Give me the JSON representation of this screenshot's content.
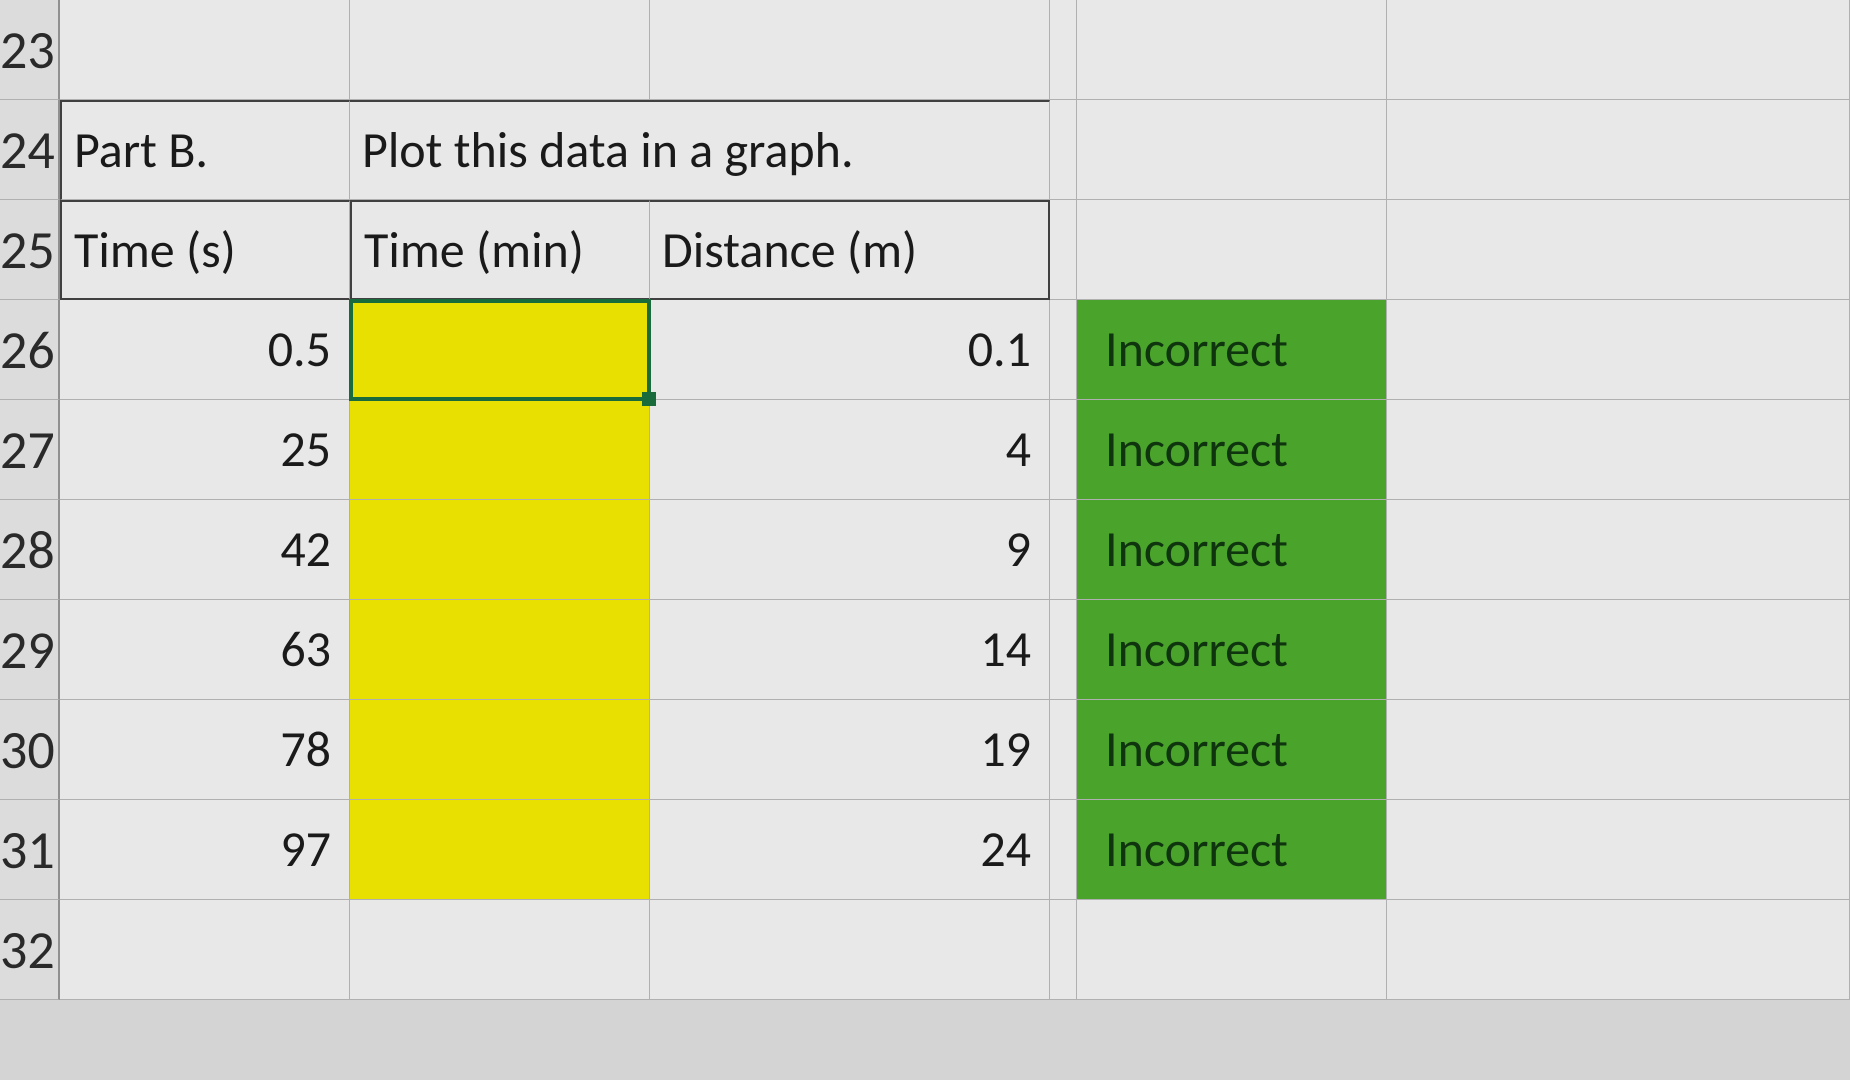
{
  "rows": {
    "r23": "23",
    "r24": "24",
    "r25": "25",
    "r26": "26",
    "r27": "27",
    "r28": "28",
    "r29": "29",
    "r30": "30",
    "r31": "31",
    "r32": "32"
  },
  "header": {
    "part": "Part B.",
    "instruction": "Plot this data in a graph.",
    "col_time_s": "Time (s)",
    "col_time_min": "Time (min)",
    "col_distance": "Distance (m)"
  },
  "data": {
    "time_s": [
      "0.5",
      "25",
      "42",
      "63",
      "78",
      "97"
    ],
    "time_min": [
      "",
      "",
      "",
      "",
      "",
      ""
    ],
    "distance": [
      "0.1",
      "4",
      "9",
      "14",
      "19",
      "24"
    ],
    "status": [
      "Incorrect",
      "Incorrect",
      "Incorrect",
      "Incorrect",
      "Incorrect",
      "Incorrect"
    ]
  },
  "chart_data": {
    "type": "table",
    "columns": [
      "Time (s)",
      "Time (min)",
      "Distance (m)"
    ],
    "rows": [
      [
        0.5,
        null,
        0.1
      ],
      [
        25,
        null,
        4
      ],
      [
        42,
        null,
        9
      ],
      [
        63,
        null,
        14
      ],
      [
        78,
        null,
        19
      ],
      [
        97,
        null,
        24
      ]
    ],
    "note": "Time (min) column is blank (highlighted yellow, to be filled in). Status column shows 'Incorrect' for every row."
  }
}
